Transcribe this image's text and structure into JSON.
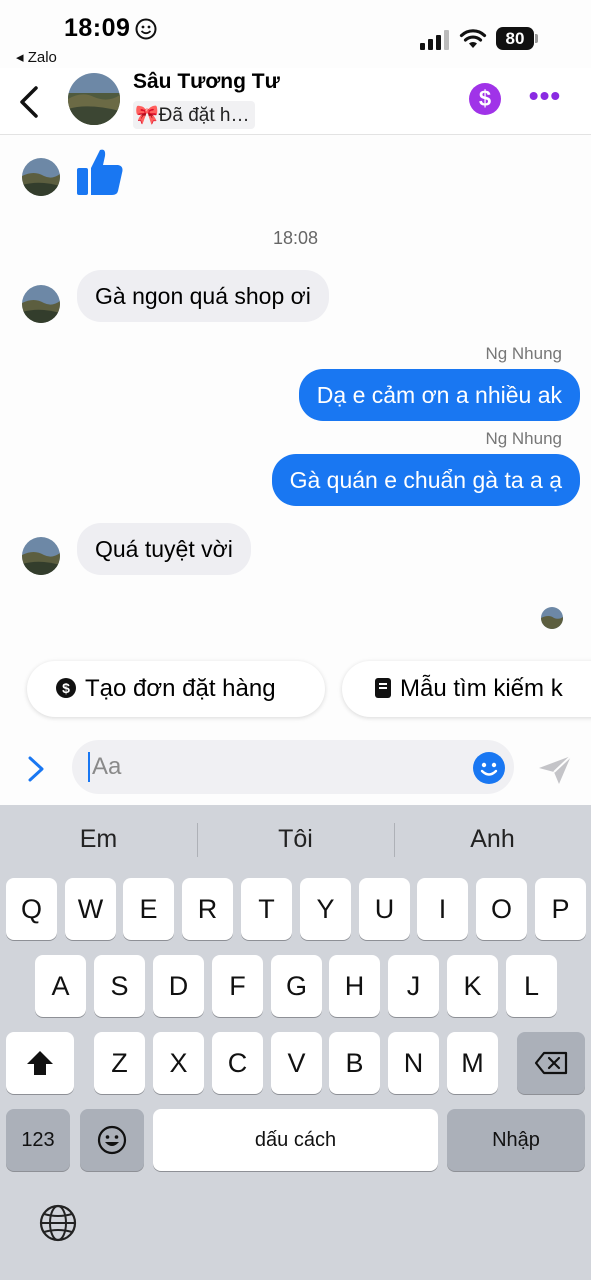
{
  "status_bar": {
    "time": "18:09",
    "back_app": "◂ Zalo",
    "battery": "80"
  },
  "header": {
    "contact_name": "Sâu Tương Tư",
    "status": "🎀Đã đặt h…",
    "dollar_symbol": "$",
    "more_symbol": "•••"
  },
  "conversation": {
    "timestamp": "18:08",
    "messages": [
      {
        "direction": "in",
        "type": "like-sticker",
        "icon": "thumbs-up-icon"
      },
      {
        "direction": "in",
        "text": "Gà ngon quá shop ơi"
      },
      {
        "direction": "out",
        "sender": "Ng Nhung",
        "text": "Dạ e cảm ơn a nhiều ak"
      },
      {
        "direction": "out",
        "sender": "Ng Nhung",
        "text": "Gà quán e chuẩn gà ta a ạ"
      },
      {
        "direction": "in",
        "text": "Quá tuyệt vời"
      }
    ]
  },
  "quick_actions": [
    {
      "label": "Tạo đơn đặt hàng",
      "icon": "dollar-circle-icon"
    },
    {
      "label": "Mẫu tìm kiếm k",
      "icon": "document-icon"
    }
  ],
  "composer": {
    "placeholder": "Aa"
  },
  "keyboard": {
    "suggestions": [
      "Em",
      "Tôi",
      "Anh"
    ],
    "row1": [
      "Q",
      "W",
      "E",
      "R",
      "T",
      "Y",
      "U",
      "I",
      "O",
      "P"
    ],
    "row2": [
      "A",
      "S",
      "D",
      "F",
      "G",
      "H",
      "J",
      "K",
      "L"
    ],
    "row3": [
      "Z",
      "X",
      "C",
      "V",
      "B",
      "N",
      "M"
    ],
    "numbers_label": "123",
    "space_label": "dấu cách",
    "return_label": "Nhập"
  },
  "colors": {
    "accent_blue": "#1977f2",
    "incoming_bubble": "#eeeef2",
    "purple": "#a033e8",
    "keyboard_bg": "#d1d4da"
  }
}
